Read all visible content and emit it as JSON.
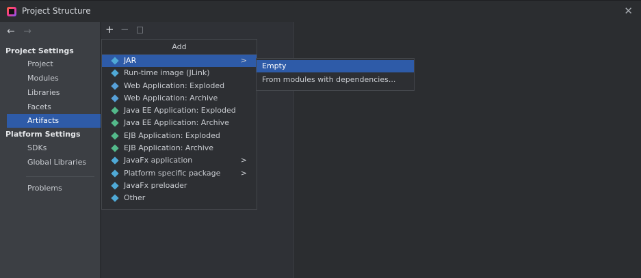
{
  "window": {
    "title": "Project Structure",
    "close_icon": "close-icon"
  },
  "navigation": {
    "back": "←",
    "forward": "→"
  },
  "sidebar": {
    "project_settings_header": "Project Settings",
    "project_items": [
      "Project",
      "Modules",
      "Libraries",
      "Facets",
      "Artifacts"
    ],
    "platform_settings_header": "Platform Settings",
    "platform_items": [
      "SDKs",
      "Global Libraries"
    ],
    "problems": "Problems",
    "selected": "Artifacts"
  },
  "toolbar": {
    "add": "+",
    "remove": "−"
  },
  "popup": {
    "header": "Add",
    "items": [
      "JAR",
      "Run-time image (JLink)",
      "Web Application: Exploded",
      "Web Application: Archive",
      "Java EE Application: Exploded",
      "Java EE Application: Archive",
      "EJB Application: Exploded",
      "EJB Application: Archive",
      "JavaFx application",
      "Platform specific package",
      "JavaFx preloader",
      "Other"
    ],
    "selected": "JAR",
    "chevron": ">"
  },
  "submenu": {
    "items": [
      "Empty",
      "From modules with dependencies..."
    ],
    "selected": "Empty"
  },
  "colors": {
    "selection": "#2e5ba8",
    "background": "#2b2d30",
    "sidebar": "#3c3f44"
  }
}
